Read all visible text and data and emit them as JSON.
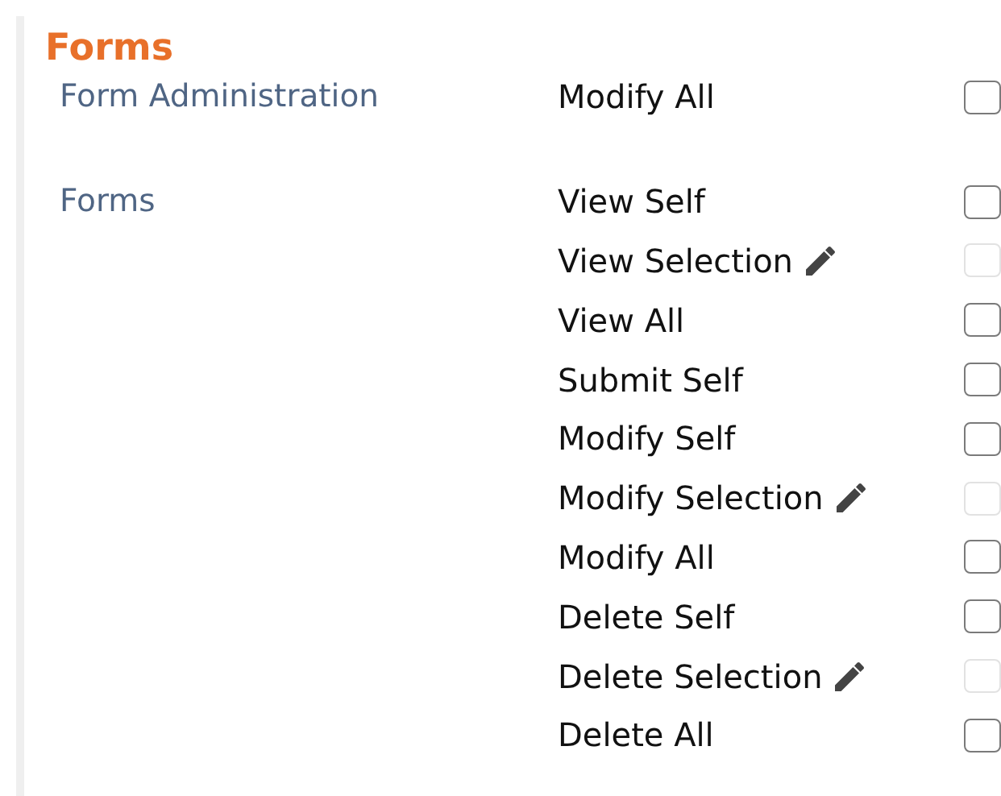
{
  "section": {
    "title": "Forms"
  },
  "groups": [
    {
      "label": "Form Administration",
      "permissions": [
        {
          "label": "Modify All",
          "editable": false,
          "disabled": false,
          "checked": false
        }
      ]
    },
    {
      "label": "Forms",
      "permissions": [
        {
          "label": "View Self",
          "editable": false,
          "disabled": false,
          "checked": false
        },
        {
          "label": "View Selection",
          "editable": true,
          "disabled": true,
          "checked": false
        },
        {
          "label": "View All",
          "editable": false,
          "disabled": false,
          "checked": false
        },
        {
          "label": "Submit Self",
          "editable": false,
          "disabled": false,
          "checked": false
        },
        {
          "label": "Modify Self",
          "editable": false,
          "disabled": false,
          "checked": false
        },
        {
          "label": "Modify Selection",
          "editable": true,
          "disabled": true,
          "checked": false
        },
        {
          "label": "Modify All",
          "editable": false,
          "disabled": false,
          "checked": false
        },
        {
          "label": "Delete Self",
          "editable": false,
          "disabled": false,
          "checked": false
        },
        {
          "label": "Delete Selection",
          "editable": true,
          "disabled": true,
          "checked": false
        },
        {
          "label": "Delete All",
          "editable": false,
          "disabled": false,
          "checked": false
        }
      ]
    }
  ]
}
